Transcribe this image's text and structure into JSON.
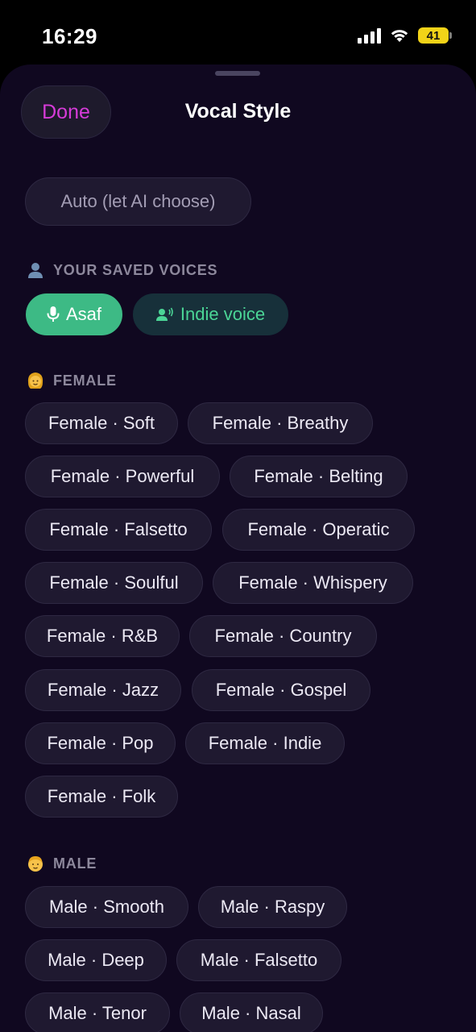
{
  "status": {
    "time": "16:29",
    "battery": "41"
  },
  "header": {
    "done_label": "Done",
    "title": "Vocal Style"
  },
  "auto_option": "Auto (let AI choose)",
  "saved_section": {
    "label": "YOUR SAVED VOICES",
    "icon": "person-icon",
    "voices": [
      {
        "label": "Asaf",
        "icon": "mic-icon"
      },
      {
        "label": "Indie voice",
        "icon": "speaking-person-icon"
      }
    ]
  },
  "female_section": {
    "label": "FEMALE",
    "icon": "woman-emoji-icon",
    "styles": [
      "Female · Soft",
      "Female · Breathy",
      "Female · Powerful",
      "Female · Belting",
      "Female · Falsetto",
      "Female · Operatic",
      "Female · Soulful",
      "Female · Whispery",
      "Female · R&B",
      "Female · Country",
      "Female · Jazz",
      "Female · Gospel",
      "Female · Pop",
      "Female · Indie",
      "Female · Folk"
    ]
  },
  "male_section": {
    "label": "MALE",
    "icon": "man-emoji-icon",
    "styles": [
      "Male · Smooth",
      "Male · Raspy",
      "Male · Deep",
      "Male · Falsetto",
      "Male · Tenor",
      "Male · Nasal"
    ]
  },
  "colors": {
    "accent": "#d63bd8",
    "saved_active": "#3dba85",
    "saved_text": "#4bd596",
    "background": "#100820"
  }
}
